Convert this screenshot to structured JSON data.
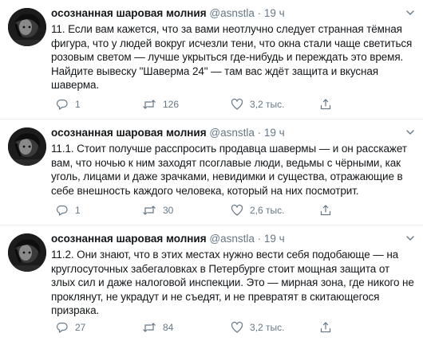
{
  "tweets": [
    {
      "author": "осознанная шаровая молния",
      "handle": "@asnstla",
      "separator": "·",
      "time": "19 ч",
      "text": "11. Если вам кажется, что за вами неотлучно следует странная тёмная фигура, что у людей вокруг исчезли тени, что окна стали чаще светиться розовым светом — лучше укрыться где-нибудь и переждать это время. Найдите вывеску \"Шаверма 24\" — там вас ждёт защита и вкусная шаверма.",
      "replies": "1",
      "retweets": "126",
      "likes": "3,2 тыс."
    },
    {
      "author": "осознанная шаровая молния",
      "handle": "@asnstla",
      "separator": "·",
      "time": "19 ч",
      "text": "11.1. Стоит получше расспросить продавца шавермы — и он расскажет вам, что ночью к ним заходят псоглавые люди, ведьмы с чёрными, как уголь, лицами и даже зрачками, невидимки и существа, отражающие в себе внешность каждого человека, который на них посмотрит.",
      "replies": "1",
      "retweets": "30",
      "likes": "2,6 тыс."
    },
    {
      "author": "осознанная шаровая молния",
      "handle": "@asnstla",
      "separator": "·",
      "time": "19 ч",
      "text": "11.2. Они знают, что в этих местах нужно вести себя подобающе — на круглосуточных забегаловках в Петербурге стоит мощная защита от злых сил и даже налоговой инспекции. Это — мирная зона, где никого не проклянут, не украдут и не съедят, и не превратят в скитающегося призрака.",
      "replies": "27",
      "retweets": "84",
      "likes": "3,2 тыс."
    }
  ],
  "icons": {
    "reply": "reply-icon",
    "retweet": "retweet-icon",
    "like": "heart-icon",
    "share": "share-icon",
    "caret": "chevron-down-icon"
  },
  "colors": {
    "text": "#14171a",
    "secondary": "#657786",
    "divider": "#e6ecf0"
  }
}
